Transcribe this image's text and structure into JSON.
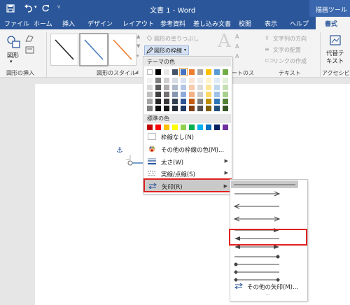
{
  "titlebar": {
    "doc_title": "文書 1  -  Word",
    "context_tab": "描画ツール",
    "save_icon": "save-icon",
    "undo_icon": "undo-icon",
    "redo_icon": "redo-icon"
  },
  "tabs": [
    "ファイル",
    "ホーム",
    "挿入",
    "デザイン",
    "レイアウト",
    "参考資料",
    "差し込み文書",
    "校閲",
    "表示",
    "ヘルプ"
  ],
  "active_tab": "書式",
  "ribbon": {
    "shapes_label": "図形",
    "insert_group": "図形の挿入",
    "styles_group": "図形のスタイル",
    "fill_label": "図形の塗りつぶし",
    "outline_label": "図形の枠線",
    "wordart_group_partial": "ートのス",
    "text_direction": "文字列の方向",
    "text_align": "文字の配置",
    "link": "リンクの作成",
    "text_group": "テキスト",
    "alt_text_line1": "代替テ",
    "alt_text_line2": "キスト",
    "access_group": "アクセシビ"
  },
  "outline_menu": {
    "theme_colors": "テーマの色",
    "standard_colors": "標準の色",
    "no_outline": "枠線なし(N)",
    "more_colors": "その他の枠線の色(M)...",
    "weight": "太さ(W)",
    "dashes": "実線/点線(S)",
    "arrows": "矢印(R)"
  },
  "theme_top": [
    "#ffffff",
    "#000000",
    "#e7e6e6",
    "#44546a",
    "#4472c4",
    "#ed7d31",
    "#a5a5a5",
    "#ffc000",
    "#5b9bd5",
    "#70ad47"
  ],
  "theme_shades": [
    [
      "#f2f2f2",
      "#7f7f7f",
      "#d0cece",
      "#d6dce4",
      "#d9e2f3",
      "#fbe5d5",
      "#ededed",
      "#fff2cc",
      "#deebf6",
      "#e2efd9"
    ],
    [
      "#d8d8d8",
      "#595959",
      "#aeabab",
      "#adb9ca",
      "#b4c6e7",
      "#f7cbac",
      "#dbdbdb",
      "#fee599",
      "#bdd7ee",
      "#c5e0b3"
    ],
    [
      "#bfbfbf",
      "#3f3f3f",
      "#757070",
      "#8496b0",
      "#8eaadb",
      "#f4b183",
      "#c9c9c9",
      "#ffd966",
      "#9dc3e6",
      "#a8d08d"
    ],
    [
      "#a5a5a5",
      "#262626",
      "#3a3838",
      "#323f4f",
      "#2f5496",
      "#c55a11",
      "#7b7b7b",
      "#bf8f00",
      "#2e75b5",
      "#538135"
    ],
    [
      "#7f7f7f",
      "#0c0c0c",
      "#171616",
      "#222a35",
      "#1f3864",
      "#833c0b",
      "#525252",
      "#7f6000",
      "#1e4e79",
      "#375623"
    ]
  ],
  "standard": [
    "#c00000",
    "#ff0000",
    "#ffc000",
    "#ffff00",
    "#92d050",
    "#00b050",
    "#00b0f0",
    "#0070c0",
    "#002060",
    "#7030a0"
  ],
  "arrows_menu": {
    "more_arrows": "その他の矢印(M)...",
    "dots": "⋯"
  }
}
